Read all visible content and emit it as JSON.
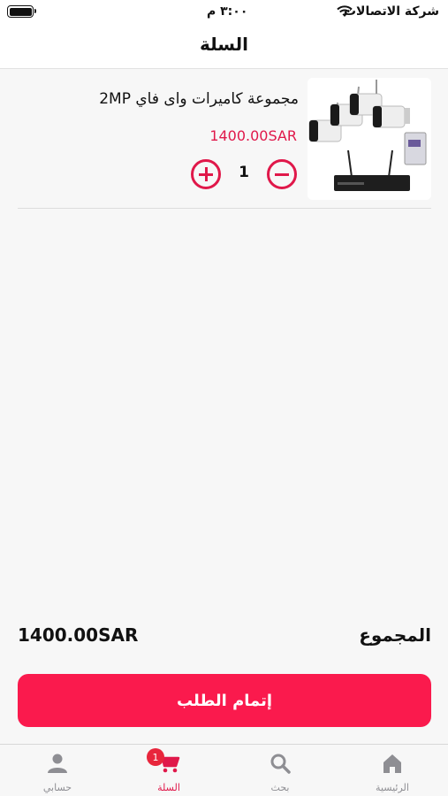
{
  "status_bar": {
    "time": "٣:٠٠ م",
    "carrier": "شركة الاتصالات"
  },
  "nav": {
    "title": "السلة"
  },
  "cart": {
    "items": [
      {
        "title": "مجموعة كاميرات واى فاي 2MP",
        "price": "1400.00SAR",
        "quantity": "1",
        "image_icon": "security-camera-kit-image"
      }
    ]
  },
  "summary": {
    "total_label": "المجموع",
    "total_value": "1400.00SAR"
  },
  "checkout": {
    "label": "إتمام الطلب"
  },
  "tabs": [
    {
      "label": "الرئيسية",
      "icon": "home-icon"
    },
    {
      "label": "بحث",
      "icon": "search-icon"
    },
    {
      "label": "السلة",
      "icon": "cart-icon",
      "badge": "1",
      "active": true
    },
    {
      "label": "حسابي",
      "icon": "person-icon"
    }
  ],
  "colors": {
    "accent": "#fa1a4d",
    "price": "#e0184a",
    "inactive_tab": "#8e8e93"
  }
}
